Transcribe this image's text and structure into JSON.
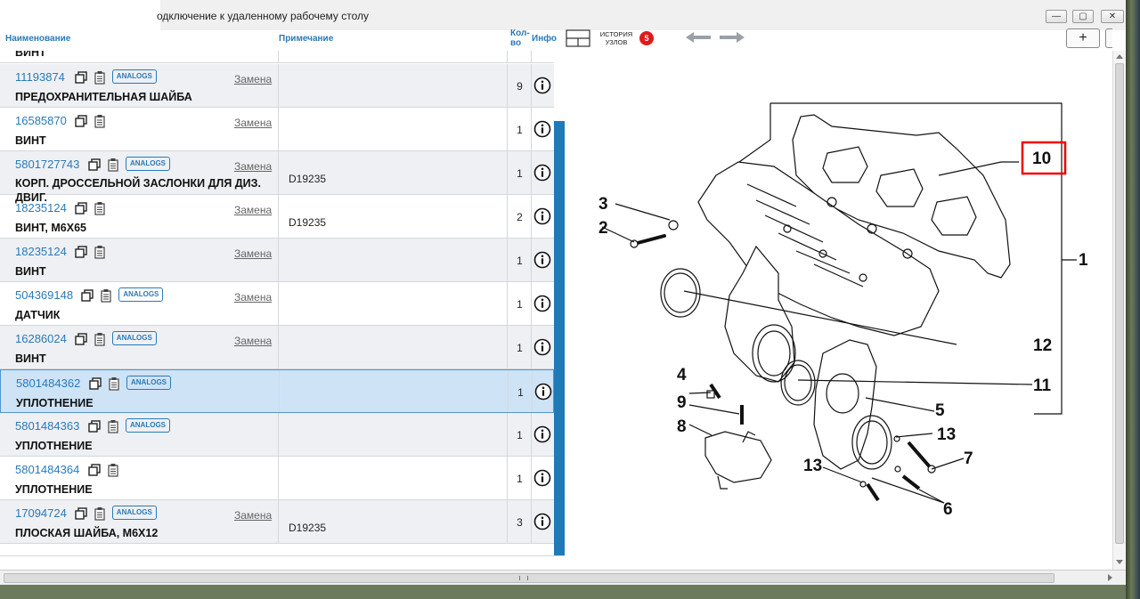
{
  "window": {
    "title": "одключение к удаленному рабочему столу",
    "min": "—",
    "max": "▢",
    "close": "✕"
  },
  "header": {
    "col_name": "Наименование",
    "col_note": "Примечание",
    "col_qty": "Кол-во",
    "col_info": "Инфо",
    "history_label": "ИСТОРИЯ УЗЛОВ",
    "history_count": "5",
    "add_label": "+"
  },
  "partial_top_name": "ВИНТ",
  "rows": [
    {
      "pn": "11193874",
      "name": "ПРЕДОХРАНИТЕЛЬНАЯ ШАЙБА",
      "analogs": "ANALOGS",
      "zamena": "Замена",
      "note": "",
      "qty": "9"
    },
    {
      "pn": "16585870",
      "name": "ВИНТ",
      "analogs": "",
      "zamena": "Замена",
      "note": "",
      "qty": "1"
    },
    {
      "pn": "5801727743",
      "name": "КОРП. ДРОССЕЛЬНОЙ ЗАСЛОНКИ ДЛЯ ДИЗ. ДВИГ.",
      "analogs": "ANALOGS",
      "zamena": "Замена",
      "note": "D19235",
      "qty": "1"
    },
    {
      "pn": "18235124",
      "name": "ВИНТ, M6X65",
      "analogs": "",
      "zamena": "Замена",
      "note": "D19235",
      "qty": "2"
    },
    {
      "pn": "18235124",
      "name": "ВИНТ",
      "analogs": "",
      "zamena": "Замена",
      "note": "",
      "qty": "1"
    },
    {
      "pn": "504369148",
      "name": "ДАТЧИК",
      "analogs": "ANALOGS",
      "zamena": "Замена",
      "note": "",
      "qty": "1"
    },
    {
      "pn": "16286024",
      "name": "ВИНТ",
      "analogs": "ANALOGS",
      "zamena": "Замена",
      "note": "",
      "qty": "1"
    },
    {
      "pn": "5801484362",
      "name": "УПЛОТНЕНИЕ",
      "analogs": "ANALOGS",
      "zamena": "",
      "note": "",
      "qty": "1"
    },
    {
      "pn": "5801484363",
      "name": "УПЛОТНЕНИЕ",
      "analogs": "ANALOGS",
      "zamena": "",
      "note": "",
      "qty": "1"
    },
    {
      "pn": "5801484364",
      "name": "УПЛОТНЕНИЕ",
      "analogs": "",
      "zamena": "",
      "note": "",
      "qty": "1"
    },
    {
      "pn": "17094724",
      "name": "ПЛОСКАЯ ШАЙБА, M6X12",
      "analogs": "ANALOGS",
      "zamena": "Замена",
      "note": "D19235",
      "qty": "3"
    }
  ],
  "diagram": {
    "callouts": [
      "1",
      "2",
      "3",
      "4",
      "5",
      "6",
      "7",
      "8",
      "9",
      "10",
      "11",
      "12",
      "13",
      "13"
    ],
    "highlighted": "10"
  },
  "colors": {
    "accent": "#2a7ab8",
    "selected_row": "#cfe3f6",
    "badge": "#e01b1b"
  }
}
